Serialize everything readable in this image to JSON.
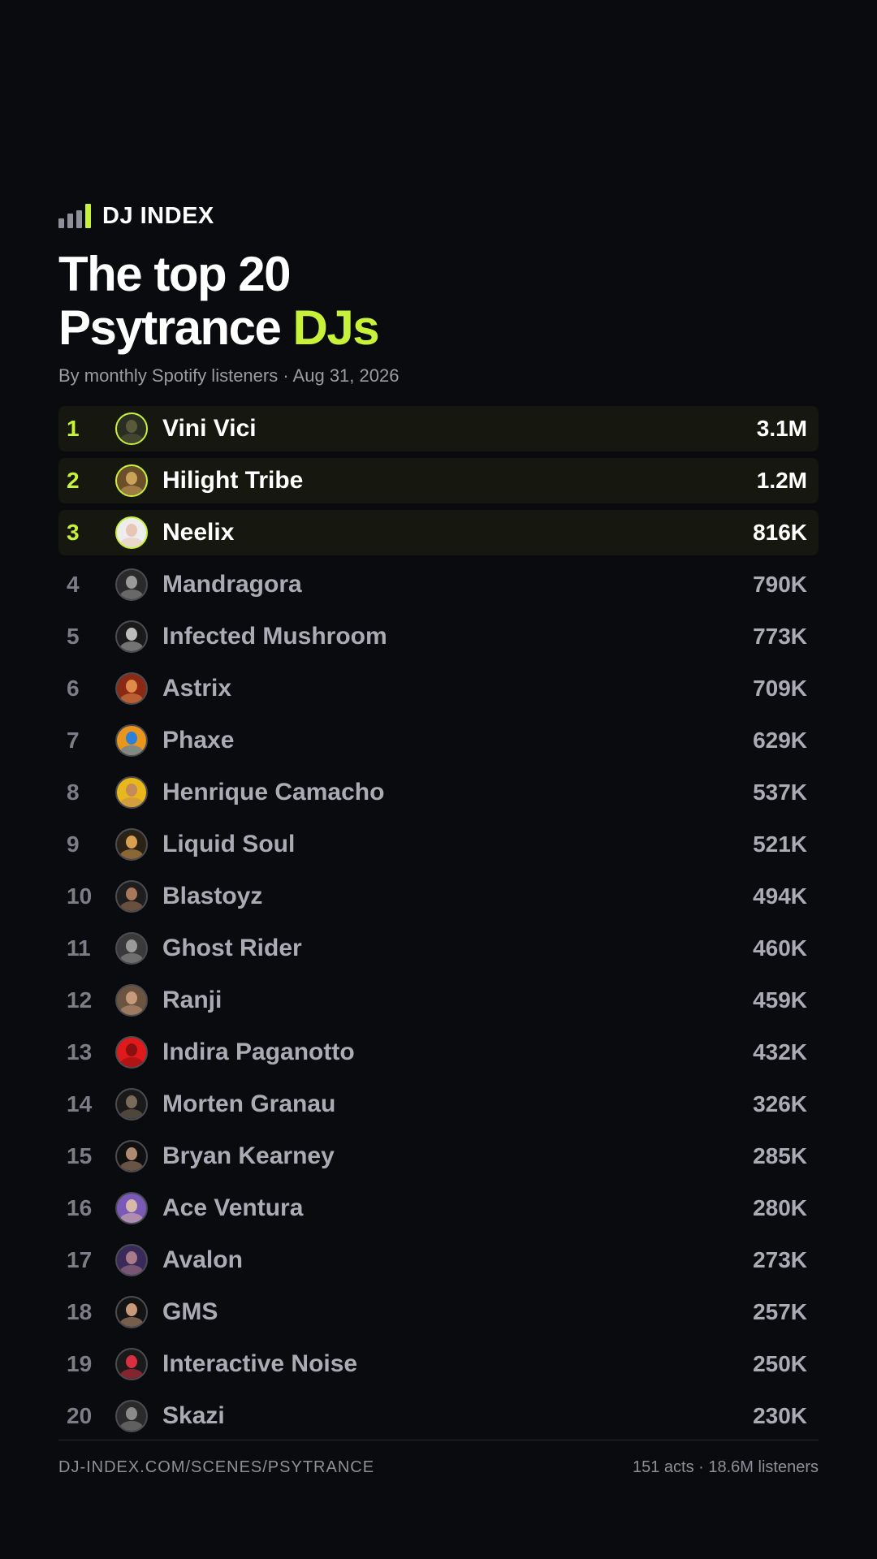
{
  "brand": {
    "name": "DJ INDEX"
  },
  "header": {
    "title_line1": "The top 20",
    "title_line2": "Psytrance",
    "title_accent": "DJs",
    "subtitle": "By monthly Spotify listeners · Aug 31, 2026"
  },
  "colors": {
    "accent": "#c8f23a",
    "background": "#0a0b0e",
    "muted": "#a9acb4"
  },
  "ranking": [
    {
      "rank": "1",
      "name": "Vini Vici",
      "listeners": "3.1M",
      "top": true,
      "avatar": [
        "#5a5a3a",
        "#2a2e22"
      ]
    },
    {
      "rank": "2",
      "name": "Hilight Tribe",
      "listeners": "1.2M",
      "top": true,
      "avatar": [
        "#c9a35a",
        "#6b4e2a"
      ]
    },
    {
      "rank": "3",
      "name": "Neelix",
      "listeners": "816K",
      "top": true,
      "avatar": [
        "#e7c6b6",
        "#ededed"
      ]
    },
    {
      "rank": "4",
      "name": "Mandragora",
      "listeners": "790K",
      "top": false,
      "avatar": [
        "#9a9a9a",
        "#2a2a2a"
      ]
    },
    {
      "rank": "5",
      "name": "Infected Mushroom",
      "listeners": "773K",
      "top": false,
      "avatar": [
        "#bdbdbd",
        "#1a1a1a"
      ]
    },
    {
      "rank": "6",
      "name": "Astrix",
      "listeners": "709K",
      "top": false,
      "avatar": [
        "#e08a4a",
        "#8a2a14"
      ]
    },
    {
      "rank": "7",
      "name": "Phaxe",
      "listeners": "629K",
      "top": false,
      "avatar": [
        "#2e7fd8",
        "#e8961c"
      ]
    },
    {
      "rank": "8",
      "name": "Henrique Camacho",
      "listeners": "537K",
      "top": false,
      "avatar": [
        "#c48a5a",
        "#e7b71c"
      ]
    },
    {
      "rank": "9",
      "name": "Liquid Soul",
      "listeners": "521K",
      "top": false,
      "avatar": [
        "#d8a050",
        "#2a2214"
      ]
    },
    {
      "rank": "10",
      "name": "Blastoyz",
      "listeners": "494K",
      "top": false,
      "avatar": [
        "#a8785a",
        "#1e1e1e"
      ]
    },
    {
      "rank": "11",
      "name": "Ghost Rider",
      "listeners": "460K",
      "top": false,
      "avatar": [
        "#9a9a9a",
        "#3a3a3a"
      ]
    },
    {
      "rank": "12",
      "name": "Ranji",
      "listeners": "459K",
      "top": false,
      "avatar": [
        "#c89a7a",
        "#6b5440"
      ]
    },
    {
      "rank": "13",
      "name": "Indira Paganotto",
      "listeners": "432K",
      "top": false,
      "avatar": [
        "#8a1010",
        "#e01a1a"
      ]
    },
    {
      "rank": "14",
      "name": "Morten Granau",
      "listeners": "326K",
      "top": false,
      "avatar": [
        "#7a6a5a",
        "#1a1a1a"
      ]
    },
    {
      "rank": "15",
      "name": "Bryan Kearney",
      "listeners": "285K",
      "top": false,
      "avatar": [
        "#b08a70",
        "#101010"
      ]
    },
    {
      "rank": "16",
      "name": "Ace Ventura",
      "listeners": "280K",
      "top": false,
      "avatar": [
        "#d8b8a8",
        "#7a5ab8"
      ]
    },
    {
      "rank": "17",
      "name": "Avalon",
      "listeners": "273K",
      "top": false,
      "avatar": [
        "#a87a8a",
        "#3a2a5a"
      ]
    },
    {
      "rank": "18",
      "name": "GMS",
      "listeners": "257K",
      "top": false,
      "avatar": [
        "#c89a7a",
        "#141414"
      ]
    },
    {
      "rank": "19",
      "name": "Interactive Noise",
      "listeners": "250K",
      "top": false,
      "avatar": [
        "#d83040",
        "#1a1a1a"
      ]
    },
    {
      "rank": "20",
      "name": "Skazi",
      "listeners": "230K",
      "top": false,
      "avatar": [
        "#8a8a8a",
        "#2a2a2a"
      ]
    }
  ],
  "footer": {
    "url": "DJ-INDEX.COM/SCENES/PSYTRANCE",
    "stats": "151 acts · 18.6M listeners"
  }
}
